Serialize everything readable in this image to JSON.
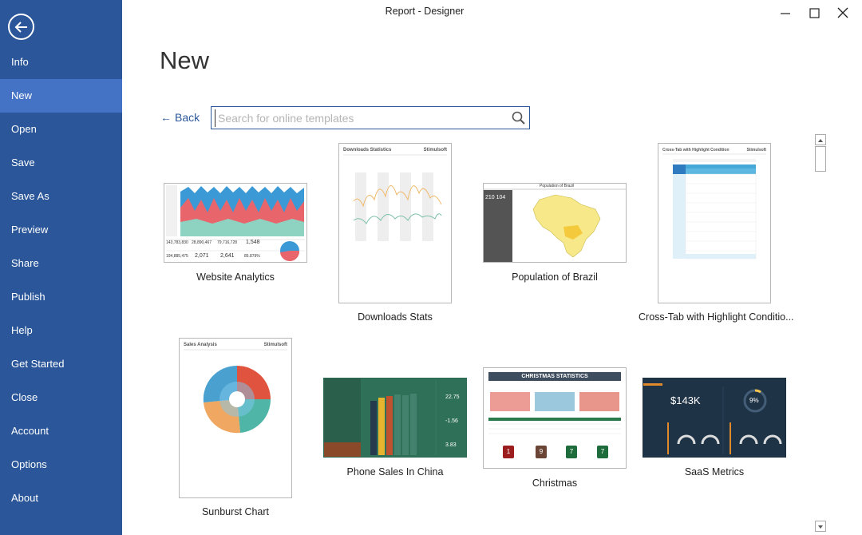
{
  "window": {
    "title": "Report - Designer"
  },
  "sidebar": {
    "items": [
      {
        "label": "Info"
      },
      {
        "label": "New"
      },
      {
        "label": "Open"
      },
      {
        "label": "Save"
      },
      {
        "label": "Save As"
      },
      {
        "label": "Preview"
      },
      {
        "label": "Share"
      },
      {
        "label": "Publish"
      },
      {
        "label": "Help"
      },
      {
        "label": "Get Started"
      },
      {
        "label": "Close"
      },
      {
        "label": "Account"
      },
      {
        "label": "Options"
      },
      {
        "label": "About"
      }
    ],
    "active": "New"
  },
  "main": {
    "title": "New",
    "back_label": "Back",
    "search": {
      "placeholder": "Search for online templates",
      "value": ""
    }
  },
  "templates": [
    {
      "label": "Website Analytics",
      "stats": [
        "143,783,830",
        "28,890,467",
        "79,716,728",
        "1,548",
        "194,885,475",
        "2,071",
        "2,641",
        "85.879%"
      ]
    },
    {
      "label": "Downloads Stats",
      "header": "Downloads Statistics",
      "brand": "Stimulsoft"
    },
    {
      "label": "Population of Brazil",
      "header": "Population of Brazil",
      "stat": "210 104"
    },
    {
      "label": "Cross-Tab with Highlight Conditio...",
      "header": "Cross-Tab with Highlight Condition",
      "brand": "Stimulsoft"
    },
    {
      "label": "Sunburst Chart",
      "header": "Sales Analysis",
      "brand": "Stimulsoft"
    },
    {
      "label": "Phone Sales In China",
      "values": [
        "22.75",
        "-1.56",
        "3.83"
      ]
    },
    {
      "label": "Christmas",
      "header": "CHRISTMAS STATISTICS",
      "badges": [
        "1",
        "9",
        "7",
        "7"
      ]
    },
    {
      "label": "SaaS Metrics",
      "value": "$143K",
      "percent": "9%"
    }
  ],
  "colors": {
    "sidebar": "#2b579a",
    "active": "#4472c4",
    "accent": "#2b579a"
  }
}
